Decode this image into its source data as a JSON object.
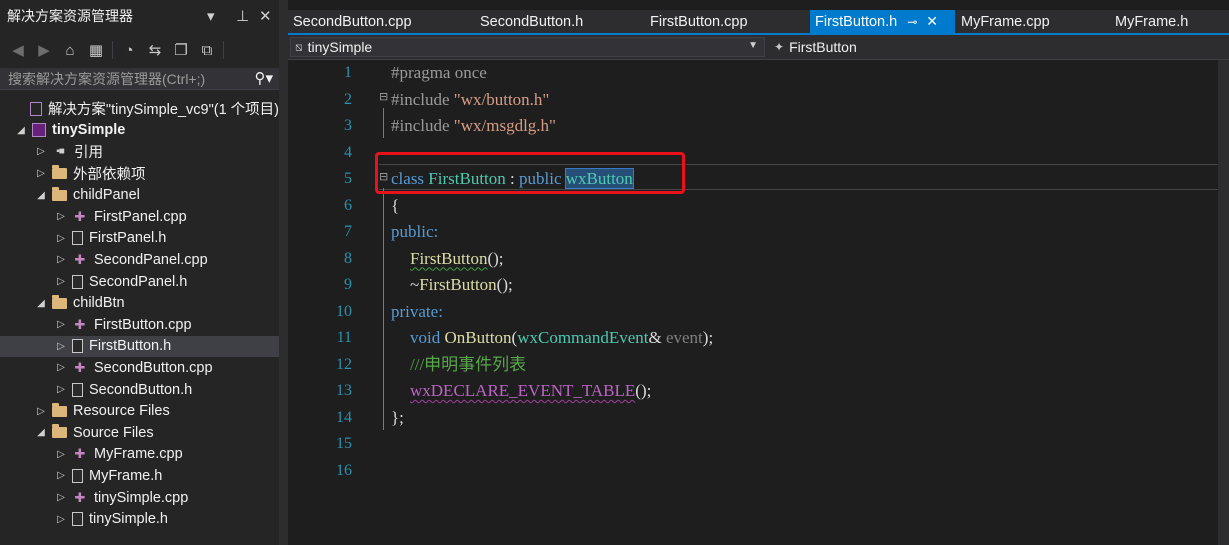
{
  "solution_explorer": {
    "title": "解决方案资源管理器",
    "search_placeholder": "搜索解决方案资源管理器(Ctrl+;)",
    "items": [
      {
        "label": "解决方案\"tinySimple_vc9\"(1 个项目)",
        "icon": "solution-icon",
        "level": 0,
        "expander": "",
        "bold": false
      },
      {
        "label": "tinySimple",
        "icon": "project-icon",
        "level": 0,
        "expander": "expanded",
        "bold": true
      },
      {
        "label": "引用",
        "icon": "references-icon",
        "level": 1,
        "expander": "collapsed",
        "bold": false
      },
      {
        "label": "外部依赖项",
        "icon": "folder-icon",
        "level": 1,
        "expander": "collapsed",
        "bold": false
      },
      {
        "label": "childPanel",
        "icon": "folder-icon",
        "level": 1,
        "expander": "expanded",
        "bold": false
      },
      {
        "label": "FirstPanel.cpp",
        "icon": "cpp-file-icon",
        "level": 2,
        "expander": "collapsed",
        "bold": false
      },
      {
        "label": "FirstPanel.h",
        "icon": "header-file-icon",
        "level": 2,
        "expander": "collapsed",
        "bold": false
      },
      {
        "label": "SecondPanel.cpp",
        "icon": "cpp-file-icon",
        "level": 2,
        "expander": "collapsed",
        "bold": false
      },
      {
        "label": "SecondPanel.h",
        "icon": "header-file-icon",
        "level": 2,
        "expander": "collapsed",
        "bold": false
      },
      {
        "label": "childBtn",
        "icon": "folder-icon",
        "level": 1,
        "expander": "expanded",
        "bold": false
      },
      {
        "label": "FirstButton.cpp",
        "icon": "cpp-file-icon",
        "level": 2,
        "expander": "collapsed",
        "bold": false
      },
      {
        "label": "FirstButton.h",
        "icon": "header-file-icon",
        "level": 2,
        "expander": "collapsed",
        "bold": false,
        "selected": true
      },
      {
        "label": "SecondButton.cpp",
        "icon": "cpp-file-icon",
        "level": 2,
        "expander": "collapsed",
        "bold": false
      },
      {
        "label": "SecondButton.h",
        "icon": "header-file-icon",
        "level": 2,
        "expander": "collapsed",
        "bold": false
      },
      {
        "label": "Resource Files",
        "icon": "folder-icon",
        "level": 1,
        "expander": "collapsed",
        "bold": false
      },
      {
        "label": "Source Files",
        "icon": "folder-icon",
        "level": 1,
        "expander": "expanded",
        "bold": false
      },
      {
        "label": "MyFrame.cpp",
        "icon": "cpp-file-icon",
        "level": 2,
        "expander": "collapsed",
        "bold": false
      },
      {
        "label": "MyFrame.h",
        "icon": "header-file-icon",
        "level": 2,
        "expander": "collapsed",
        "bold": false
      },
      {
        "label": "tinySimple.cpp",
        "icon": "cpp-file-icon",
        "level": 2,
        "expander": "collapsed",
        "bold": false
      },
      {
        "label": "tinySimple.h",
        "icon": "header-file-icon",
        "level": 2,
        "expander": "collapsed",
        "bold": false
      }
    ]
  },
  "tabs": [
    {
      "label": "SecondButton.cpp",
      "active": false
    },
    {
      "label": "SecondButton.h",
      "active": false
    },
    {
      "label": "FirstButton.cpp",
      "active": false
    },
    {
      "label": "FirstButton.h",
      "active": true
    },
    {
      "label": "MyFrame.cpp",
      "active": false
    },
    {
      "label": "MyFrame.h",
      "active": false
    }
  ],
  "navbar": {
    "project": "tinySimple",
    "scope": "FirstButton"
  },
  "editor": {
    "line_numbers": [
      "1",
      "2",
      "3",
      "4",
      "5",
      "6",
      "7",
      "8",
      "9",
      "10",
      "11",
      "12",
      "13",
      "14",
      "15",
      "16"
    ],
    "code": {
      "l1": "#pragma once",
      "l2a": "#include ",
      "l2b": "\"wx/button.h\"",
      "l3a": "#include ",
      "l3b": "\"wx/msgdlg.h\"",
      "l5_class": "class",
      "l5_name": "FirstButton",
      "l5_colon": " : ",
      "l5_public": "public",
      "l5_base": "wxButton",
      "l6": "{",
      "l7": "public:",
      "l8_fn": "FirstButton",
      "l8_rest": "();",
      "l9_tilde": "~",
      "l9_fn": "FirstButton",
      "l9_rest": "();",
      "l10": "private:",
      "l11_void": "void",
      "l11_fn": "OnButton",
      "l11_p1": "(",
      "l11_type": "wxCommandEvent",
      "l11_amp": "& ",
      "l11_param": "event",
      "l11_end": ");",
      "l12": "///申明事件列表",
      "l13_mac": "wxDECLARE_EVENT_TABLE",
      "l13_rest": "();",
      "l14": "};"
    }
  },
  "colors": {
    "accent": "#007acc",
    "highlight_box": "#e8111c",
    "selection": "#264f78"
  }
}
